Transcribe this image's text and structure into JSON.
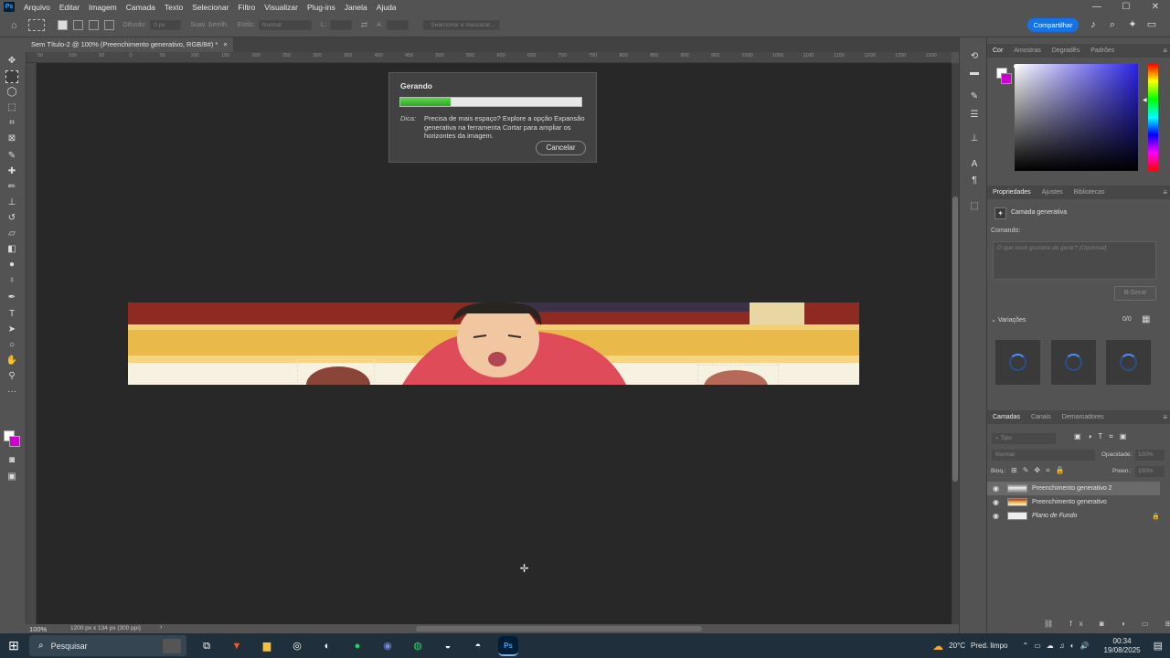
{
  "app": {
    "logo": "Ps"
  },
  "menu": [
    "Arquivo",
    "Editar",
    "Imagem",
    "Camada",
    "Texto",
    "Selecionar",
    "Filtro",
    "Visualizar",
    "Plug-ins",
    "Janela",
    "Ajuda"
  ],
  "window_controls": {
    "minimize": "—",
    "maximize": "☐",
    "close": "✕"
  },
  "options": {
    "difusao_label": "Difusão:",
    "difusao_value": "0 px",
    "suav_label": "Suav. Serrilh.",
    "estilo_label": "Estilo:",
    "estilo_value": "Normal",
    "largura_label": "L:",
    "altura_label": "A:",
    "select_mask": "Selecionar e mascarar..."
  },
  "share_button": "Compartilhar",
  "document": {
    "tab_title": "Sem Título-2 @ 100% (Preenchimento generativo, RGB/8#) *",
    "tab_close": "×"
  },
  "ruler_labels": [
    "50",
    "100",
    "50",
    "0",
    "50",
    "100",
    "150",
    "200",
    "250",
    "300",
    "350",
    "400",
    "450",
    "500",
    "550",
    "600",
    "650",
    "700",
    "750",
    "800",
    "850",
    "900",
    "950",
    "1000",
    "1050",
    "1100",
    "1150",
    "1200",
    "1250",
    "1300"
  ],
  "dialog": {
    "title": "Gerando",
    "progress": 0.28,
    "tip_label": "Dica:",
    "tip_text": "Precisa de mais espaço? Explore a opção Expansão generativa na ferramenta Cortar para ampliar os horizontes da imagem.",
    "cancel": "Cancelar"
  },
  "status": {
    "zoom": "100%",
    "doc_info": "1200 px x 134 px (300 ppi)"
  },
  "panels": {
    "color_tabs": [
      "Cor",
      "Amostras",
      "Degradês",
      "Padrões"
    ],
    "props_tabs": [
      "Propriedades",
      "Ajustes",
      "Bibliotecas"
    ],
    "layer_type": "Camada generativa",
    "prompt_label": "Comando:",
    "prompt_placeholder": "O que você gostaria de gerar? (Opcional)",
    "generate": "Gerar",
    "variations_label": "Variações",
    "variations_count": "0/0",
    "layers_tabs": [
      "Camadas",
      "Canais",
      "Demarcadores"
    ],
    "layers_search": "Tipo",
    "blend_mode": "Normal",
    "opacity_label": "Opacidade:",
    "opacity_value": "100%",
    "lock_label": "Bloq.:",
    "fill_label": "Preen.:",
    "fill_value": "100%",
    "layers": [
      "Preenchimento generativo 2",
      "Preenchimento generativo",
      "Plano de Fundo"
    ]
  },
  "colors": {
    "accent": "#1473e6",
    "background_swatch": "#d000d0",
    "progress": "#3cc12c"
  },
  "taskbar": {
    "search": "Pesquisar",
    "apps": [
      "task-view",
      "brave",
      "file-explorer",
      "chrome",
      "app",
      "spotify",
      "discord",
      "whatsapp",
      "app",
      "app",
      "photoshop"
    ],
    "weather": "20°C",
    "weather_desc": "Pred. limpo",
    "time": "00:34",
    "date": "19/08/2025"
  }
}
